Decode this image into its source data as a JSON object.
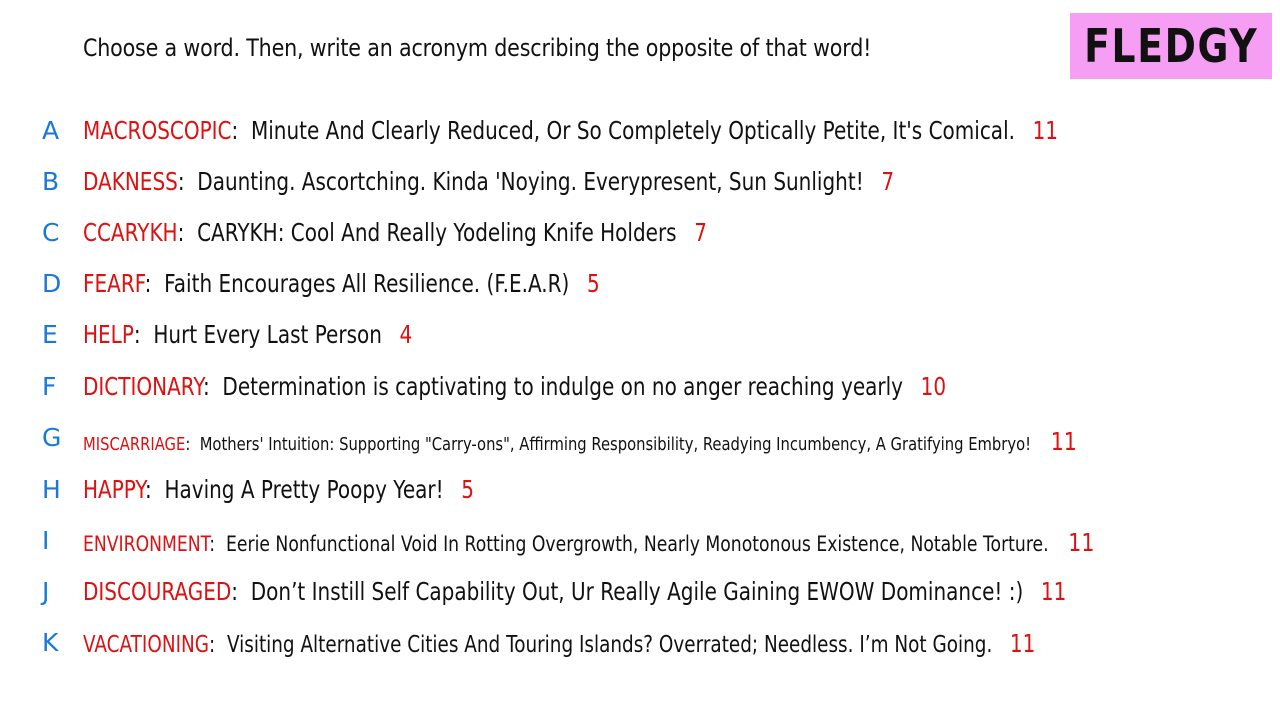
{
  "prompt": "Choose a word. Then, write an acronym describing the opposite of that word!",
  "logo": "FLEDGY",
  "colors": {
    "letter": "#1a78d6",
    "word": "#dd1111",
    "score": "#dd1111",
    "logo_bg": "#f59ef4"
  },
  "entries": [
    {
      "letter": "A",
      "word": "MACROSCOPIC",
      "acronym": "Minute And Clearly Reduced, Or So Completely Optically Petite, It's Comical.",
      "score": "11"
    },
    {
      "letter": "B",
      "word": "DAKNESS",
      "acronym": "Daunting. Ascortching. Kinda 'Noying. Everypresent, Sun Sunlight!",
      "score": "7"
    },
    {
      "letter": "C",
      "word": "CCARYKH",
      "acronym": "CARYKH: Cool And Really Yodeling Knife Holders",
      "score": "7"
    },
    {
      "letter": "D",
      "word": "FEARF",
      "acronym": "Faith Encourages All Resilience. (F.E.A.R)",
      "score": "5"
    },
    {
      "letter": "E",
      "word": "HELP",
      "acronym": "Hurt Every Last Person",
      "score": "4"
    },
    {
      "letter": "F",
      "word": "DICTIONARY",
      "acronym": "Determination is captivating to indulge on no anger reaching yearly",
      "score": "10"
    },
    {
      "letter": "G",
      "word": "MISCARRIAGE",
      "acronym": "Mothers' Intuition: Supporting \"Carry-ons\", Affirming Responsibility, Readying Incumbency, A Gratifying Embryo!",
      "score": "11"
    },
    {
      "letter": "H",
      "word": "HAPPY",
      "acronym": "Having A Pretty Poopy Year!",
      "score": "5"
    },
    {
      "letter": "I",
      "word": "ENVIRONMENT",
      "acronym": "Eerie Nonfunctional Void In Rotting Overgrowth, Nearly Monotonous Existence, Notable Torture.",
      "score": "11"
    },
    {
      "letter": "J",
      "word": "DISCOURAGED",
      "acronym": "Don’t Instill Self Capability Out, Ur Really Agile Gaining EWOW Dominance! :)",
      "score": "11"
    },
    {
      "letter": "K",
      "word": "VACATIONING",
      "acronym": "Visiting Alternative Cities And Touring Islands? Overrated; Needless. I’m Not Going.",
      "score": "11"
    }
  ]
}
